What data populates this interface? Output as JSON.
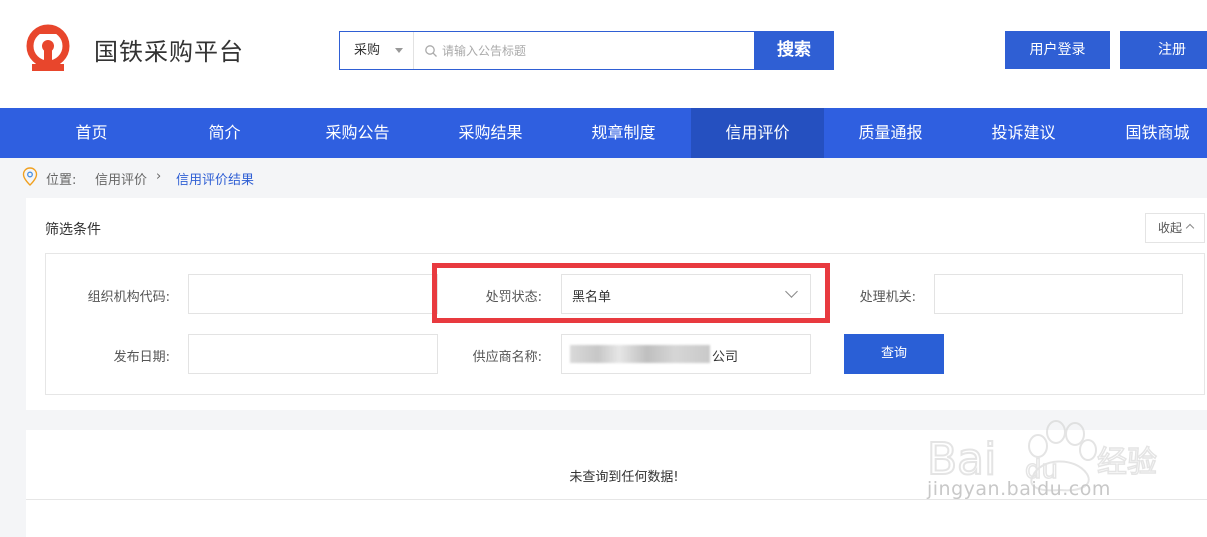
{
  "header": {
    "site_name": "国铁采购平台",
    "search": {
      "category": "采购",
      "placeholder": "请输入公告标题",
      "button": "搜索"
    },
    "login_button": "用户登录",
    "register_button": "注册"
  },
  "nav": {
    "items": [
      "首页",
      "简介",
      "采购公告",
      "采购结果",
      "规章制度",
      "信用评价",
      "质量通报",
      "投诉建议",
      "国铁商城"
    ],
    "active": "信用评价"
  },
  "breadcrumb": {
    "label": "位置:",
    "parent": "信用评价",
    "current": "信用评价结果"
  },
  "filter": {
    "title": "筛选条件",
    "collapse": "收起",
    "org_code_label": "组织机构代码:",
    "org_code_value": "",
    "penalty_status_label": "处罚状态:",
    "penalty_status_value": "黑名单",
    "authority_label": "处理机关:",
    "authority_value": "",
    "publish_date_label": "发布日期:",
    "publish_date_value": "",
    "supplier_label": "供应商名称:",
    "supplier_value_suffix": "公司",
    "query_button": "查询"
  },
  "results": {
    "empty_message": "未查询到任何数据!"
  },
  "watermark": {
    "text": "jingyan.baidu.com",
    "brand": "Baidu 经验"
  },
  "colors": {
    "primary": "#2f5fd4",
    "nav": "#2f5fe0",
    "nav_active": "#2550c0",
    "logo_red": "#e8462c",
    "highlight": "#e83a3f"
  }
}
